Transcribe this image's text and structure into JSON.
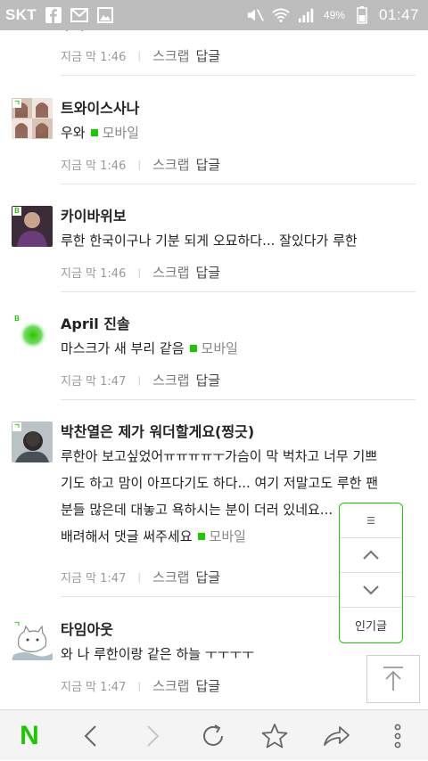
{
  "status_bar": {
    "carrier": "SKT",
    "battery": "49%",
    "time": "01:47"
  },
  "comments": [
    {
      "author": "",
      "text_lines": [
        "우와 ..."
      ],
      "mobile_tag": "",
      "time": "지금 막 1:46",
      "scrap": "스크랩",
      "reply": "답글"
    },
    {
      "author": "트와이스사나",
      "badge": "ㄱ",
      "text_lines": [
        "우와"
      ],
      "mobile_tag": "모바일",
      "time": "지금 막 1:46",
      "scrap": "스크랩",
      "reply": "답글"
    },
    {
      "author": "카이바위보",
      "badge": "B",
      "text_lines": [
        "루한 한국이구나 기분 되게 오묘하다... 잘있다가 루한"
      ],
      "mobile_tag": "",
      "time": "지금 막 1:46",
      "scrap": "스크랩",
      "reply": "답글"
    },
    {
      "author": "April 진솔",
      "badge": "B",
      "text_lines": [
        "마스크가 새 부리 같음"
      ],
      "mobile_tag": "모바일",
      "time": "지금 막 1:47",
      "scrap": "스크랩",
      "reply": "답글"
    },
    {
      "author": "박찬열은 제가 워더할게요(찡긋)",
      "badge": "ㄱ",
      "text_lines": [
        "루한아 보고싶었어ㅠㅠㅠㅠㅜ가슴이 막 벅차고 너무 기쁘",
        "기도 하고 맘이 아프다기도 하다... 여기 저말고도 루한 팬",
        "분들 많은데 대놓고 욕하시는 분이 더러 있네요...",
        "배려해서 댓글 써주세요"
      ],
      "mobile_tag": "모바일",
      "time": "지금 막 1:47",
      "scrap": "스크랩",
      "reply": "답글"
    },
    {
      "author": "타임아웃",
      "badge": "ㄱ",
      "text_lines": [
        "와 나 루한이랑 같은 하늘 ㅜㅜㅜㅜ"
      ],
      "mobile_tag": "",
      "time": "지금 막 1:47",
      "scrap": "스크랩",
      "reply": "답글"
    }
  ],
  "float_nav": {
    "menu_icon": "menu-icon",
    "up_icon": "chevron-up-icon",
    "down_icon": "chevron-down-icon",
    "popular_label": "인기글"
  },
  "top_button_icon": "arrow-to-top-icon",
  "bottom_bar": {
    "home_logo": "N",
    "icons": [
      "naver-home-icon",
      "back-icon",
      "forward-icon",
      "refresh-icon",
      "bookmark-star-icon",
      "share-icon",
      "more-icon"
    ]
  },
  "colors": {
    "accent": "#1ec800",
    "status_bar": "#bdbdbd",
    "text": "#222222",
    "meta": "#999999"
  }
}
